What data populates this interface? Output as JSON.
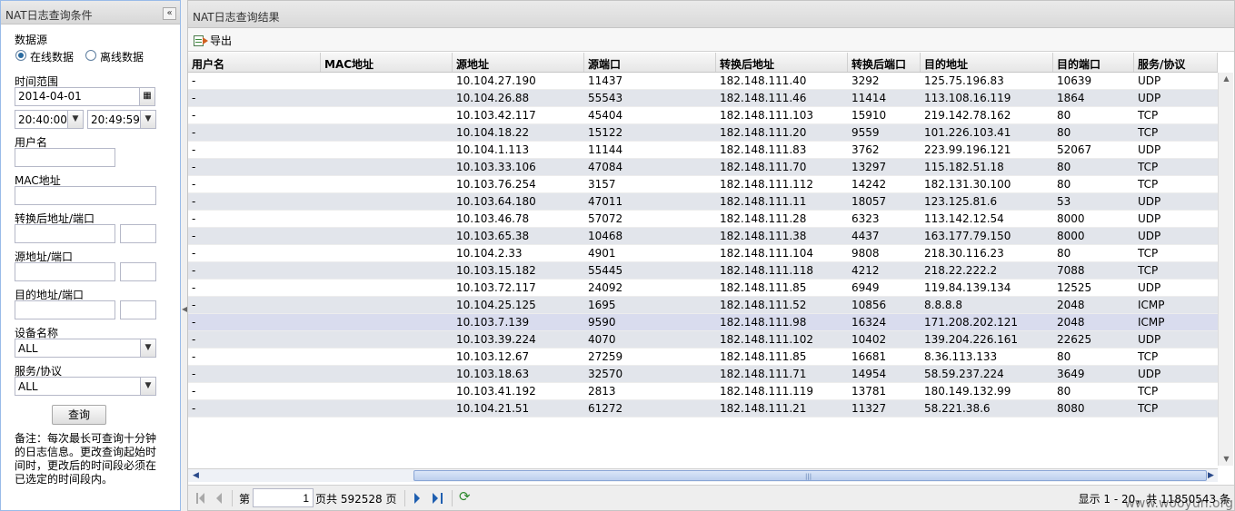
{
  "left": {
    "title": "NAT日志查询条件",
    "collapse_glyph": "«",
    "data_source_label": "数据源",
    "radio_online": "在线数据",
    "radio_offline": "离线数据",
    "time_range_label": "时间范围",
    "date_value": "2014-04-01",
    "time_start": "20:40:00",
    "time_end": "20:49:59",
    "username_label": "用户名",
    "mac_label": "MAC地址",
    "translated_label": "转换后地址/端口",
    "source_label": "源地址/端口",
    "dest_label": "目的地址/端口",
    "device_label": "设备名称",
    "device_value": "ALL",
    "service_label": "服务/协议",
    "service_value": "ALL",
    "query_button": "查询",
    "note": "备注：每次最长可查询十分钟的日志信息。更改查询起始时间时，更改后的时间段必须在已选定的时间段内。"
  },
  "right": {
    "title": "NAT日志查询结果",
    "export_label": "导出",
    "columns": [
      "用户名",
      "MAC地址",
      "源地址",
      "源端口",
      "转换后地址",
      "转换后端口",
      "目的地址",
      "目的端口",
      "服务/协议"
    ],
    "rows": [
      [
        "-",
        "",
        "10.104.27.190",
        "11437",
        "182.148.111.40",
        "3292",
        "125.75.196.83",
        "10639",
        "UDP"
      ],
      [
        "-",
        "",
        "10.104.26.88",
        "55543",
        "182.148.111.46",
        "11414",
        "113.108.16.119",
        "1864",
        "UDP"
      ],
      [
        "-",
        "",
        "10.103.42.117",
        "45404",
        "182.148.111.103",
        "15910",
        "219.142.78.162",
        "80",
        "TCP"
      ],
      [
        "-",
        "",
        "10.104.18.22",
        "15122",
        "182.148.111.20",
        "9559",
        "101.226.103.41",
        "80",
        "TCP"
      ],
      [
        "-",
        "",
        "10.104.1.113",
        "11144",
        "182.148.111.83",
        "3762",
        "223.99.196.121",
        "52067",
        "UDP"
      ],
      [
        "-",
        "",
        "10.103.33.106",
        "47084",
        "182.148.111.70",
        "13297",
        "115.182.51.18",
        "80",
        "TCP"
      ],
      [
        "-",
        "",
        "10.103.76.254",
        "3157",
        "182.148.111.112",
        "14242",
        "182.131.30.100",
        "80",
        "TCP"
      ],
      [
        "-",
        "",
        "10.103.64.180",
        "47011",
        "182.148.111.11",
        "18057",
        "123.125.81.6",
        "53",
        "UDP"
      ],
      [
        "-",
        "",
        "10.103.46.78",
        "57072",
        "182.148.111.28",
        "6323",
        "113.142.12.54",
        "8000",
        "UDP"
      ],
      [
        "-",
        "",
        "10.103.65.38",
        "10468",
        "182.148.111.38",
        "4437",
        "163.177.79.150",
        "8000",
        "UDP"
      ],
      [
        "-",
        "",
        "10.104.2.33",
        "4901",
        "182.148.111.104",
        "9808",
        "218.30.116.23",
        "80",
        "TCP"
      ],
      [
        "-",
        "",
        "10.103.15.182",
        "55445",
        "182.148.111.118",
        "4212",
        "218.22.222.2",
        "7088",
        "TCP"
      ],
      [
        "-",
        "",
        "10.103.72.117",
        "24092",
        "182.148.111.85",
        "6949",
        "119.84.139.134",
        "12525",
        "UDP"
      ],
      [
        "-",
        "",
        "10.104.25.125",
        "1695",
        "182.148.111.52",
        "10856",
        "8.8.8.8",
        "2048",
        "ICMP"
      ],
      [
        "-",
        "",
        "10.103.7.139",
        "9590",
        "182.148.111.98",
        "16324",
        "171.208.202.121",
        "2048",
        "ICMP"
      ],
      [
        "-",
        "",
        "10.103.39.224",
        "4070",
        "182.148.111.102",
        "10402",
        "139.204.226.161",
        "22625",
        "UDP"
      ],
      [
        "-",
        "",
        "10.103.12.67",
        "27259",
        "182.148.111.85",
        "16681",
        "8.36.113.133",
        "80",
        "TCP"
      ],
      [
        "-",
        "",
        "10.103.18.63",
        "32570",
        "182.148.111.71",
        "14954",
        "58.59.237.224",
        "3649",
        "UDP"
      ],
      [
        "-",
        "",
        "10.103.41.192",
        "2813",
        "182.148.111.119",
        "13781",
        "180.149.132.99",
        "80",
        "TCP"
      ],
      [
        "-",
        "",
        "10.104.21.51",
        "61272",
        "182.148.111.21",
        "11327",
        "58.221.38.6",
        "8080",
        "TCP"
      ]
    ],
    "pager": {
      "page_prefix": "第",
      "page_value": "1",
      "page_suffix": "页共 592528 页",
      "summary": "显示 1 - 20，共 11850543 条"
    }
  },
  "watermark": "www.wooyun.org"
}
